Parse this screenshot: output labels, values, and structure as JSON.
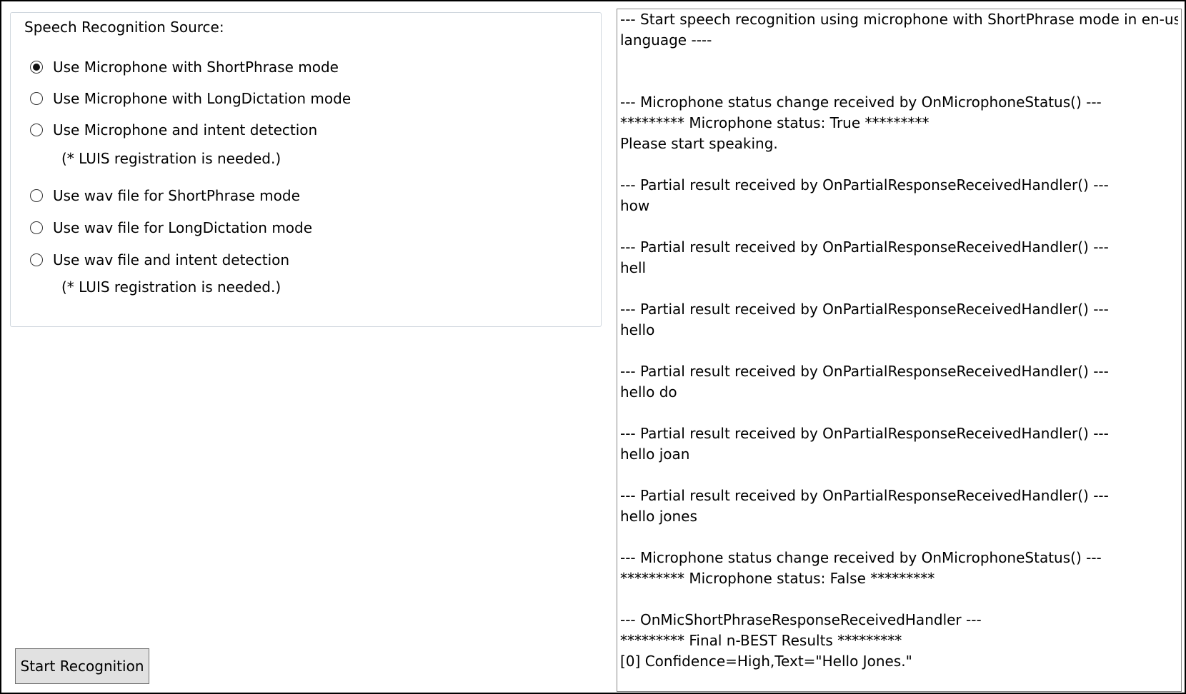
{
  "source_group": {
    "label": "Speech Recognition Source:",
    "options": [
      {
        "label": "Use Microphone with ShortPhrase mode",
        "checked": true
      },
      {
        "label": "Use Microphone with LongDictation mode",
        "checked": false
      },
      {
        "label": "Use Microphone and intent detection",
        "checked": false,
        "note": "(* LUIS registration is needed.)"
      },
      {
        "label": "Use wav file for ShortPhrase mode",
        "checked": false
      },
      {
        "label": "Use wav file for LongDictation mode",
        "checked": false
      },
      {
        "label": "Use wav file and intent detection",
        "checked": false,
        "note": "(* LUIS registration is needed.)"
      }
    ]
  },
  "start_button": {
    "label": "Start Recognition"
  },
  "log": {
    "lines": [
      "--- Start speech recognition using microphone with ShortPhrase mode in en-us",
      "language ----",
      "",
      "",
      "--- Microphone status change received by OnMicrophoneStatus() ---",
      "********* Microphone status: True *********",
      "Please start speaking.",
      "",
      "--- Partial result received by OnPartialResponseReceivedHandler() ---",
      "how",
      "",
      "--- Partial result received by OnPartialResponseReceivedHandler() ---",
      "hell",
      "",
      "--- Partial result received by OnPartialResponseReceivedHandler() ---",
      "hello",
      "",
      "--- Partial result received by OnPartialResponseReceivedHandler() ---",
      "hello do",
      "",
      "--- Partial result received by OnPartialResponseReceivedHandler() ---",
      "hello joan",
      "",
      "--- Partial result received by OnPartialResponseReceivedHandler() ---",
      "hello jones",
      "",
      "--- Microphone status change received by OnMicrophoneStatus() ---",
      "********* Microphone status: False *********",
      "",
      "--- OnMicShortPhraseResponseReceivedHandler ---",
      "********* Final n-BEST Results *********",
      "[0] Confidence=High,Text=\"Hello Jones.\""
    ]
  }
}
